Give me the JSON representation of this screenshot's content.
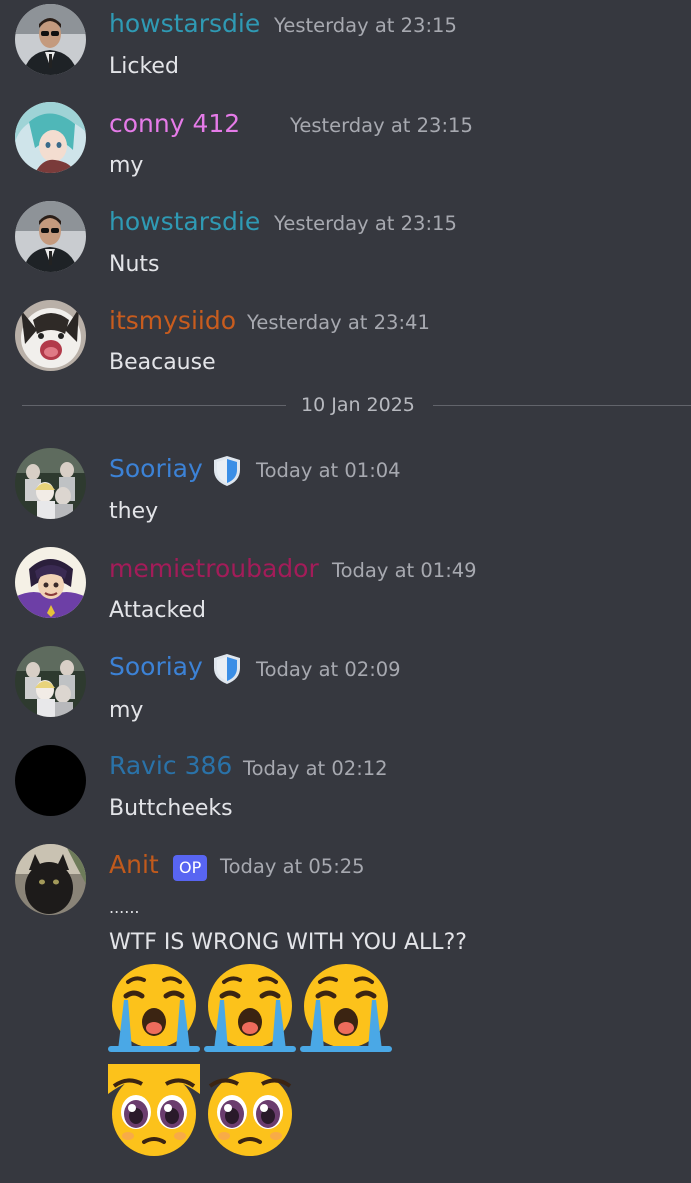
{
  "messages": [
    {
      "user": "howstarsdie",
      "user_color": "#2f9ab4",
      "time": "Yesterday at 23:15",
      "text": "Licked",
      "avatar": "suit-man-sunglasses-avatar"
    },
    {
      "user": "conny 412",
      "user_color": "#e57be8",
      "time": "Yesterday at 23:15",
      "text": "my",
      "avatar": "anime-girl-teal-hair-avatar"
    },
    {
      "user": "howstarsdie",
      "user_color": "#2f9ab4",
      "time": "Yesterday at 23:15",
      "text": "Nuts",
      "avatar": "suit-man-sunglasses-avatar"
    },
    {
      "user": "itsmysiido",
      "user_color": "#c85c1e",
      "time": "Yesterday at 23:41",
      "text": "Beacause",
      "avatar": "screaming-cat-avatar"
    },
    {
      "user": "Sooriay",
      "user_color": "#3c82d6",
      "time": "Today at 01:04",
      "text": "they",
      "avatar": "group-photo-avatar"
    },
    {
      "user": "memietroubador",
      "user_color": "#a31c59",
      "time": "Today at 01:49",
      "text": "Attacked",
      "avatar": "anime-character-purple-avatar"
    },
    {
      "user": "Sooriay",
      "user_color": "#3c82d6",
      "time": "Today at 02:09",
      "text": "my",
      "avatar": "group-photo-avatar"
    },
    {
      "user": "Ravic 386",
      "user_color": "#2a72a8",
      "time": "Today at 02:12",
      "text": "Buttcheeks",
      "avatar": "black-avatar"
    },
    {
      "user": "Anit",
      "user_color": "#c15a1c",
      "time": "Today at 05:25",
      "badge": "OP",
      "lines": [
        "......",
        "WTF IS WRONG WITH YOU ALL??"
      ],
      "avatar": "cat-photo-avatar"
    }
  ],
  "date_divider": "10 Jan 2025",
  "emojis": {
    "row1": [
      "loudly-crying-emoji",
      "loudly-crying-emoji",
      "loudly-crying-emoji"
    ],
    "row2": [
      "pleading-face-emoji",
      "pleading-face-emoji"
    ]
  },
  "colors": {
    "background": "#36383f",
    "timestamp": "#a7a9b0",
    "op_badge": "#5865f2",
    "shield": "#3a8ee6"
  }
}
